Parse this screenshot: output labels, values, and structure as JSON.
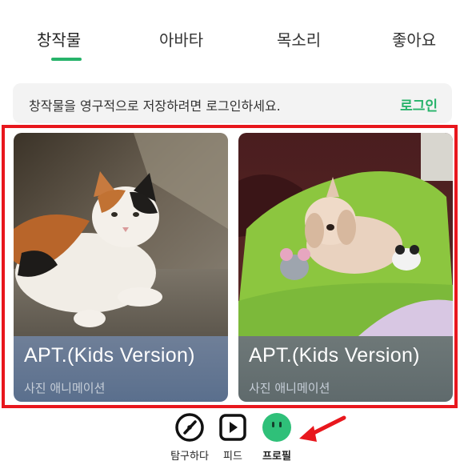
{
  "tabs": [
    {
      "label": "창작물"
    },
    {
      "label": "아바타"
    },
    {
      "label": "목소리"
    },
    {
      "label": "좋아요"
    }
  ],
  "login_banner": {
    "text": "창작물을 영구적으로 저장하려면 로그인하세요.",
    "link": "로그인"
  },
  "cards": [
    {
      "title": "APT.(Kids Version)",
      "subtitle": "사진 애니메이션",
      "image": "calico-cat-photo"
    },
    {
      "title": "APT.(Kids Version)",
      "subtitle": "사진 애니메이션",
      "image": "small-dog-on-green-pillow-photo"
    }
  ],
  "bottom_nav": [
    {
      "label": "탐구하다",
      "icon": "compass-icon"
    },
    {
      "label": "피드",
      "icon": "play-icon"
    },
    {
      "label": "프로필",
      "icon": "profile-face-icon"
    }
  ],
  "colors": {
    "accent": "#27b36a",
    "highlight": "#e8171d",
    "arrow": "#e8171d"
  }
}
